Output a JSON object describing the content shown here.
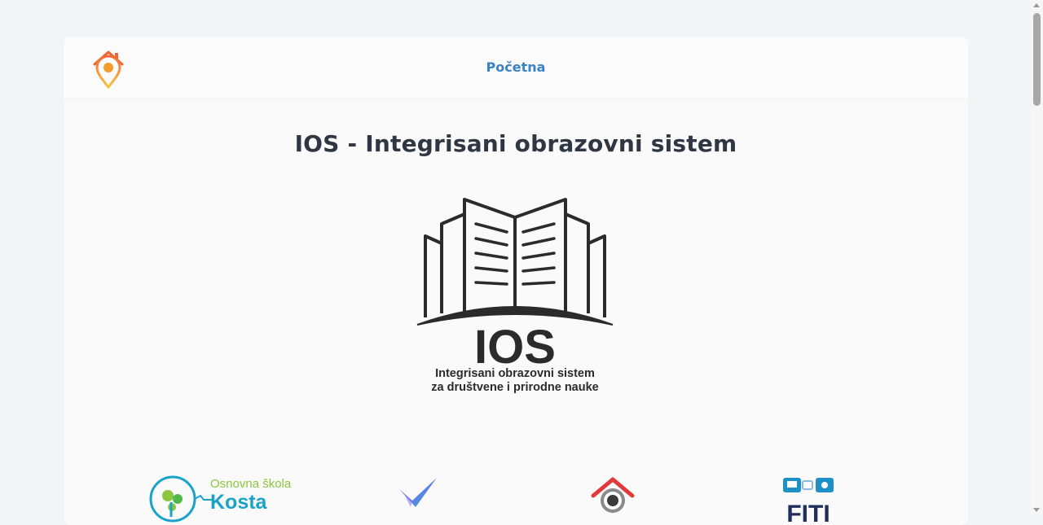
{
  "nav": {
    "home_label": "Početna"
  },
  "main": {
    "title": "IOS - Integrisani obrazovni sistem"
  },
  "hero_logo": {
    "wordmark": "IOS",
    "subtitle_line1": "Integrisani obrazovni sistem",
    "subtitle_line2": "za društvene i prirodne nauke"
  },
  "partners": {
    "school": {
      "line1": "Osnovna škola",
      "line2": "Kosta"
    },
    "fiti": {
      "text": "FITI"
    }
  },
  "colors": {
    "background": "#f3f4f6",
    "accent_link": "#3b82c4",
    "title": "#2f3744",
    "logo_dark": "#2b2b2b",
    "brand_orange": "#f08a24",
    "school_green": "#8cc63f",
    "school_blue": "#1aa3c9"
  }
}
